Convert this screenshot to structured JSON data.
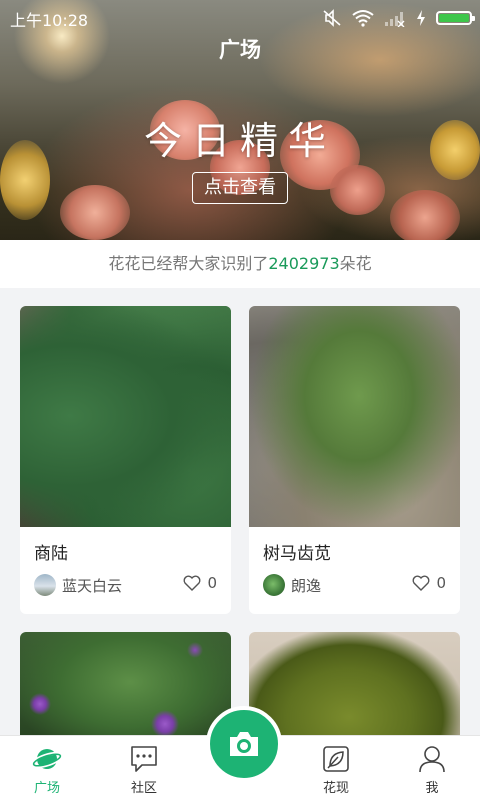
{
  "status_bar": {
    "time": "上午10:28"
  },
  "header": {
    "title": "广场"
  },
  "banner": {
    "title": "今日精华",
    "button_label": "点击查看"
  },
  "counter": {
    "prefix": "花花已经帮大家识别了",
    "count": "2402973",
    "suffix": "朵花"
  },
  "posts": [
    {
      "name": "商陆",
      "user": "蓝天白云",
      "likes": "0"
    },
    {
      "name": "树马齿苋",
      "user": "朗逸",
      "likes": "0"
    },
    {
      "name": "",
      "user": "",
      "likes": ""
    },
    {
      "name": "",
      "user": "",
      "likes": ""
    }
  ],
  "tabs": [
    {
      "label": "广场",
      "icon": "planet-icon",
      "active": true
    },
    {
      "label": "社区",
      "icon": "chat-icon",
      "active": false
    },
    {
      "label": "花现",
      "icon": "leaf-icon",
      "active": false
    },
    {
      "label": "我",
      "icon": "person-icon",
      "active": false
    }
  ],
  "camera": {
    "icon": "camera-icon"
  },
  "colors": {
    "accent": "#1db374",
    "count": "#1a9a5a",
    "battery": "#3ec64b",
    "background": "#f2f3f5"
  }
}
